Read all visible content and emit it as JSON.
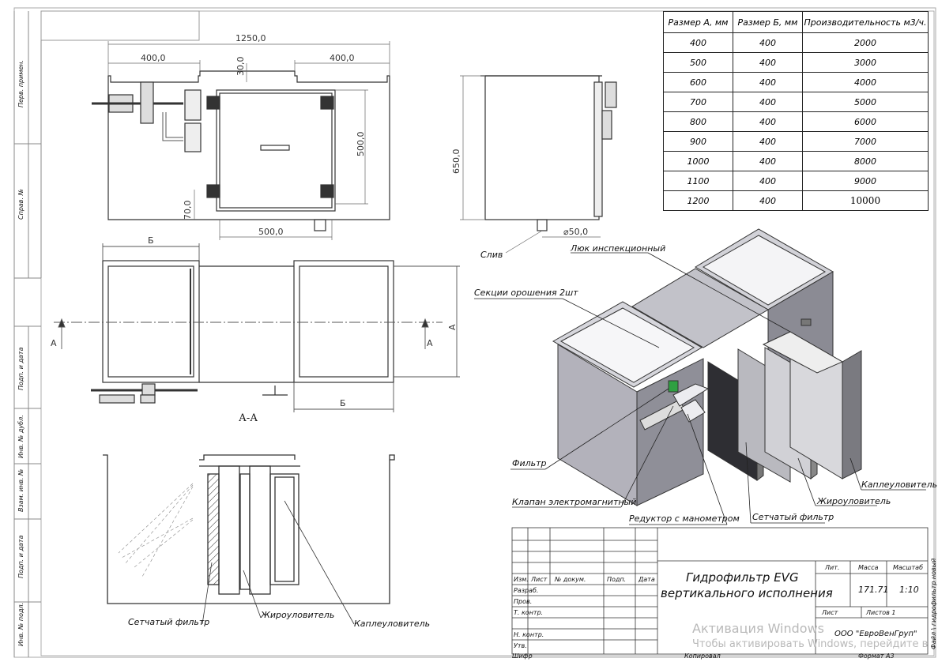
{
  "side_stamp": {
    "perv_primen": "Перв. примен.",
    "sprav": "Справ. №",
    "podp_data_1": "Подп. и дата",
    "inv_dubl": "Инв. № дубл.",
    "vzam_inv": "Взам. инв. №",
    "podp_data_2": "Подп. и дата",
    "inv_podl": "Инв. № подл."
  },
  "dims": {
    "overall": "1250,0",
    "left_w": "400,0",
    "right_w": "400,0",
    "d30": "30,0",
    "d500v": "500,0",
    "d70": "70,0",
    "d500h": "500,0",
    "d650": "650,0",
    "d_phi": "⌀50,0",
    "b_top": "Б",
    "b_bottom": "Б",
    "a_right": "А",
    "section_left": "А",
    "section_right": "А",
    "section_title": "А-А"
  },
  "spec_table": {
    "headers": [
      "Размер А, мм",
      "Размер Б, мм",
      "Производительность м3/ч."
    ],
    "rows": [
      [
        "400",
        "400",
        "2000"
      ],
      [
        "500",
        "400",
        "3000"
      ],
      [
        "600",
        "400",
        "4000"
      ],
      [
        "700",
        "400",
        "5000"
      ],
      [
        "800",
        "400",
        "6000"
      ],
      [
        "900",
        "400",
        "7000"
      ],
      [
        "1000",
        "400",
        "8000"
      ],
      [
        "1100",
        "400",
        "9000"
      ],
      [
        "1200",
        "400",
        "10000"
      ]
    ]
  },
  "callouts": {
    "sliv": "Слив",
    "luk": "Люк инспекционный",
    "sekcii": "Секции орошения 2шт",
    "filtr": "Фильтр",
    "klapan": "Клапан электромагнитный",
    "reduktor": "Редуктор с манометром",
    "setch_3d": "Сетчатый фильтр",
    "zhir_3d": "Жироуловитель",
    "kaple_3d": "Каплеуловитель",
    "setch_sec": "Сетчатый фильтр",
    "zhir_sec": "Жироуловитель",
    "kaple_sec": "Каплеуловитель"
  },
  "title_block": {
    "izm": "Изм.",
    "list": "Лист",
    "n_dokum": "№ докум.",
    "podp": "Подп.",
    "data": "Дата",
    "razrab": "Разраб.",
    "prov": "Пров.",
    "t_kontr": "Т. контр.",
    "n_kontr": "Н. контр.",
    "utv": "Утв.",
    "title_line1": "Гидрофильтр EVG",
    "title_line2": "вертикального исполнения",
    "lit": "Лит.",
    "massa": "Масса",
    "masshtab": "Масштаб",
    "massa_val": "171.71",
    "masshtab_val": "1:10",
    "list2": "Лист",
    "listov": "Листов 1",
    "company": "ООО \"ЕвроВенГруп\"",
    "shifr": "Шифр",
    "kopiroval": "Копировал",
    "format": "Формат А3",
    "file_note": "Файл \\ гидрофильтр новый"
  },
  "watermark": {
    "line1": "Активация Windows",
    "line2": "Чтобы активировать Windows, перейдите в"
  }
}
